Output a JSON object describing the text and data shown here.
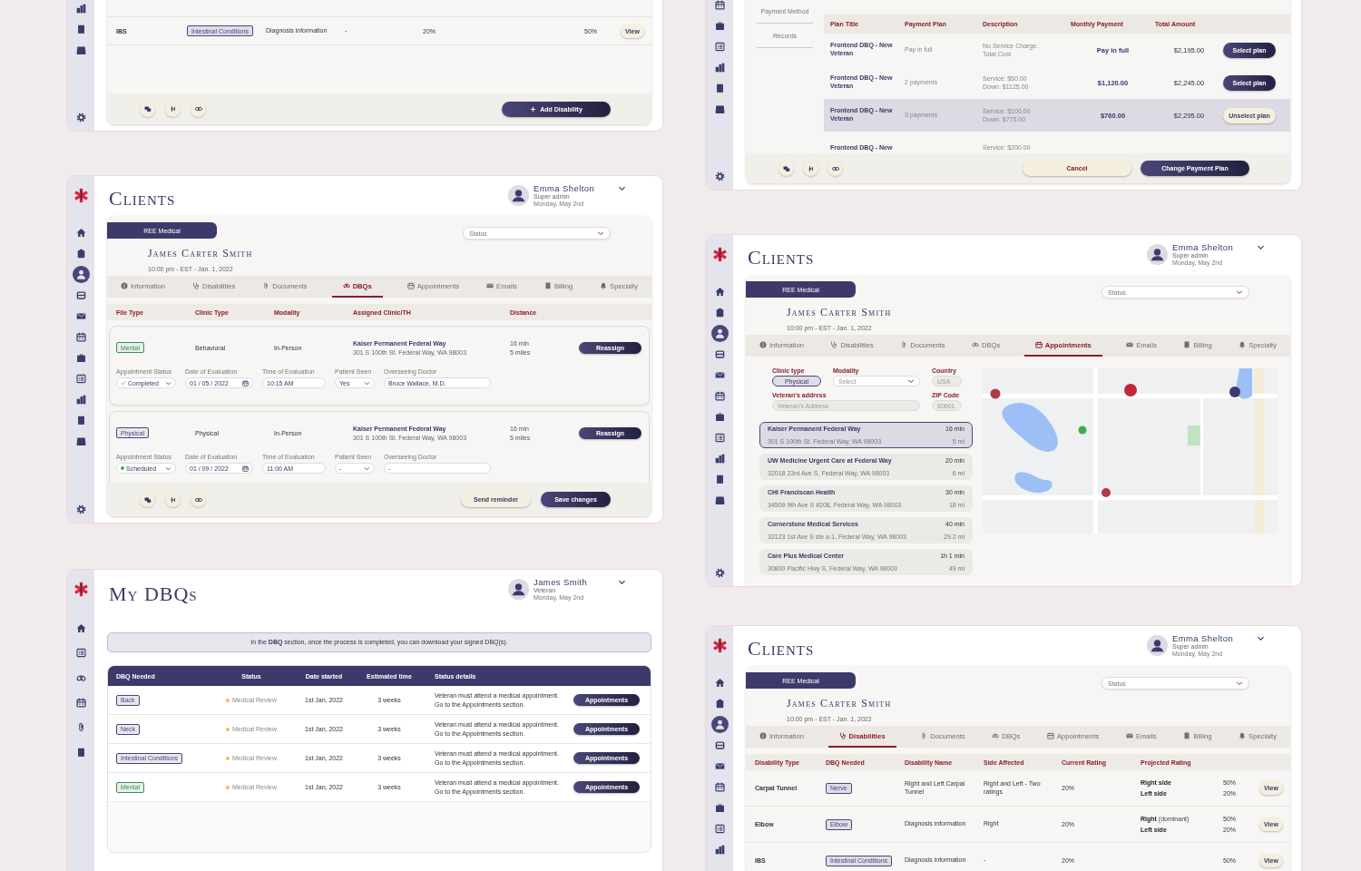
{
  "disabilities_tail": {
    "rows": [
      {
        "type": "IBS",
        "dbq": "Intestinal Conditions",
        "name": "Diagnosis information",
        "side": "-",
        "current": "20%",
        "projected": [
          {
            "value": "50%"
          }
        ],
        "action": "View"
      }
    ],
    "footer_buttons": [
      {
        "label": "Add Disability",
        "kind": "add"
      }
    ]
  },
  "payment_plans": {
    "subnav": [
      "Payment Method",
      "Records"
    ],
    "columns": [
      "Plan Title",
      "Payment Plan",
      "Description",
      "Monthly Payment",
      "Total Amount"
    ],
    "rows": [
      {
        "title": "Frontend DBQ - New Veteran",
        "plan": "Pay in full",
        "description": [
          "No Service Charge.",
          "Total Cost"
        ],
        "monthly": "Pay in full",
        "total": "$2,195.00",
        "action": "Select plan",
        "selected": false
      },
      {
        "title": "Frontend DBQ - New Veteran",
        "plan": "2 payments",
        "description": [
          "Service: $50.00",
          "Down: $1125.00"
        ],
        "monthly": "$1,120.00",
        "total": "$2,245.00",
        "action": "Select plan",
        "selected": false
      },
      {
        "title": "Frontend DBQ - New Veteran",
        "plan": "3 payments",
        "description": [
          "Service: $100.00",
          "Down: $775.00"
        ],
        "monthly": "$760.00",
        "total": "$2,295.00",
        "action": "Unselect plan",
        "selected": true
      },
      {
        "title": "Frontend DBQ - New",
        "description": [
          "Service: $200.00"
        ],
        "selected": false
      }
    ],
    "footer_buttons": [
      {
        "label": "Cancel",
        "kind": "cancel"
      },
      {
        "label": "Change Payment Plan",
        "kind": "primary"
      }
    ]
  },
  "clients_dbqs": {
    "sidebar": [
      {
        "selected": false
      },
      {
        "selected": false
      },
      {
        "selected": true
      },
      {
        "selected": false
      },
      {
        "selected": false
      },
      {
        "selected": false
      },
      {
        "selected": false
      },
      {
        "selected": false
      },
      {
        "selected": false
      },
      {
        "selected": false
      },
      {
        "selected": false
      }
    ],
    "title": "Clients",
    "user": {
      "name": "Emma Shelton",
      "role": "Super admin",
      "date": "Monday, May 2nd"
    },
    "client": {
      "org": "REE Medical",
      "name": "James Carter Smith",
      "meta": "10:00 pm - EST - Jan. 1, 2022"
    },
    "status_filter": {
      "placeholder": "Status"
    },
    "tabs": [
      {
        "label": "Information",
        "selected": false
      },
      {
        "label": "Disabilities",
        "selected": false
      },
      {
        "label": "Documents",
        "selected": false
      },
      {
        "label": "DBQs",
        "selected": true
      },
      {
        "label": "Appointments",
        "selected": false
      },
      {
        "label": "Emails",
        "selected": false
      },
      {
        "label": "Billing",
        "selected": false
      },
      {
        "label": "Specialty",
        "selected": false
      }
    ],
    "columns": [
      "File Type",
      "Clinic Type",
      "Modality",
      "Assigned Clinic/TH",
      "Distance"
    ],
    "rows": [
      {
        "file_type": "Mental",
        "color": "#3e8e55",
        "clinic_type": "Behavioral",
        "modality": "In-Person",
        "clinic": "Kaiser Permanent Federal Way",
        "address": "301 S 100th St. Federal Way, WA 98003",
        "time": "16 min",
        "distance": "5 miles",
        "action": "Reassign",
        "fields": [
          {
            "kind": "status",
            "label": "Appointment Status",
            "value": "Completed",
            "completed": true
          },
          {
            "kind": "date",
            "label": "Date of Evaluation",
            "value": "01 / 05 / 2022"
          },
          {
            "kind": "text",
            "label": "Time of Evaluation",
            "value": "10:15 AM"
          },
          {
            "kind": "select",
            "label": "Patient Seen",
            "value": "Yes"
          },
          {
            "kind": "text",
            "label": "Overseeing Doctor",
            "value": "Bruce Wallace, M.D."
          }
        ]
      },
      {
        "file_type": "Physical",
        "color": "#4a4778",
        "clinic_type": "Physical",
        "modality": "In-Person",
        "clinic": "Kaiser Permanent Federal Way",
        "address": "301 S 100th St. Federal Way, WA 98003",
        "time": "16 min",
        "distance": "5 miles",
        "action": "Reassign",
        "fields": [
          {
            "kind": "status",
            "label": "Appointment Status",
            "value": "Scheduled",
            "completed": false
          },
          {
            "kind": "date",
            "label": "Date of Evaluation",
            "value": "01 / 09 / 2022"
          },
          {
            "kind": "text",
            "label": "Time of Evaluation",
            "value": "11:00 AM"
          },
          {
            "kind": "select",
            "label": "Patient Seen",
            "value": "-"
          },
          {
            "kind": "text",
            "label": "Overseeing Doctor",
            "value": "-"
          }
        ]
      }
    ],
    "footer_buttons": [
      {
        "label": "Send reminder",
        "kind": "secondary"
      },
      {
        "label": "Save changes",
        "kind": "primary"
      }
    ]
  },
  "clients_appointments": {
    "sidebar": [
      {
        "selected": false
      },
      {
        "selected": false
      },
      {
        "selected": true
      },
      {
        "selected": false
      },
      {
        "selected": false
      },
      {
        "selected": false
      },
      {
        "selected": false
      },
      {
        "selected": false
      },
      {
        "selected": false
      },
      {
        "selected": false
      },
      {
        "selected": false
      }
    ],
    "title": "Clients",
    "user": {
      "name": "Emma Shelton",
      "role": "Super admin",
      "date": "Monday, May 2nd"
    },
    "client": {
      "org": "REE Medical",
      "name": "James Carter Smith",
      "meta": "10:00 pm - EST - Jan. 1, 2022"
    },
    "status_filter": {
      "placeholder": "Status"
    },
    "tabs": [
      {
        "label": "Information",
        "selected": false
      },
      {
        "label": "Disabilities",
        "selected": false
      },
      {
        "label": "Documents",
        "selected": false
      },
      {
        "label": "DBQs",
        "selected": false
      },
      {
        "label": "Appointments",
        "selected": true
      },
      {
        "label": "Emails",
        "selected": false
      },
      {
        "label": "Billing",
        "selected": false
      },
      {
        "label": "Specialty",
        "selected": false
      }
    ],
    "form": [
      {
        "kind": "chip",
        "label": "Clinic type",
        "value": "Physical"
      },
      {
        "kind": "select",
        "label": "Modality",
        "placeholder": "Select"
      },
      {
        "kind": "readonly",
        "label": "Country",
        "value": "USA",
        "disabled": true
      },
      {
        "kind": "input",
        "label": "Veteran's address",
        "placeholder": "Veteran's Address"
      },
      {
        "kind": "readonly",
        "label": "ZIP Code",
        "value": "60601",
        "disabled": true
      }
    ],
    "clinics": [
      {
        "name": "Kaiser Permanent Federal Way",
        "time": "16 min",
        "address": "301 S 100th St. Federal Way, WA 98003",
        "distance": "5 mi",
        "selected": true
      },
      {
        "name": "UW Medicine Urgent Care at Federal Way",
        "time": "20 min",
        "address": "32018 23rd Ave S, Federal Way, WA 98003",
        "distance": "6 mi",
        "selected": false
      },
      {
        "name": "CHI Franciscan Health",
        "time": "30 min",
        "address": "34509 9th Ave S #208, Federal Way, WA 98003",
        "distance": "18 mi",
        "selected": false
      },
      {
        "name": "Cornerstone Medical Services",
        "time": "40 min",
        "address": "32123 1st Ave S ste a-1, Federal Way, WA 98003",
        "distance": "29.2 mi",
        "selected": false
      },
      {
        "name": "Care Plus Medical Center",
        "time": "1h 1 min",
        "address": "30800 Pacific Hwy S, Federal Way, WA 98003",
        "distance": "49 mi",
        "selected": false
      }
    ]
  },
  "my_dbqs": {
    "title": "My DBQs",
    "user": {
      "name": "James Smith",
      "role": "Veteran",
      "date": "Monday, May 2nd"
    },
    "notice": "In the **DBQ** section, once the process is completed, you can download your signed DBQ(s).",
    "columns": [
      "DBQ Needed",
      "Status",
      "Date started",
      "Estimated time",
      "Status details"
    ],
    "rows": [
      {
        "dbq": "Back",
        "color": "#4a4778",
        "status": {
          "label": "Medical Review",
          "color": "#f2c230"
        },
        "started": "1st Jan, 2022",
        "estimate": "3 weeks",
        "details": [
          "Veteran must attend a medical appointment.",
          "Go to the Appointments section."
        ],
        "action": "Appointments"
      },
      {
        "dbq": "Neck",
        "color": "#4a4778",
        "status": {
          "label": "Medical Review",
          "color": "#f2c230"
        },
        "started": "1st Jan, 2022",
        "estimate": "3 weeks",
        "details": [
          "Veteran must attend a medical appointment.",
          "Go to the Appointments section."
        ],
        "action": "Appointments"
      },
      {
        "dbq": "Intestinal Conditions",
        "color": "#4a4778",
        "status": {
          "label": "Medical Review",
          "color": "#f2c230"
        },
        "started": "1st Jan, 2022",
        "estimate": "3 weeks",
        "details": [
          "Veteran must attend a medical appointment.",
          "Go to the Appointments section."
        ],
        "action": "Appointments"
      },
      {
        "dbq": "Mental",
        "color": "#3e8e55",
        "status": {
          "label": "Medical Review",
          "color": "#f2c230"
        },
        "started": "1st Jan, 2022",
        "estimate": "3 weeks",
        "details": [
          "Veteran must attend a medical appointment.",
          "Go to the Appointments section."
        ],
        "action": "Appointments"
      }
    ]
  },
  "clients_disabilities": {
    "sidebar": [
      {
        "selected": false
      },
      {
        "selected": false
      },
      {
        "selected": true
      },
      {
        "selected": false
      },
      {
        "selected": false
      },
      {
        "selected": false
      },
      {
        "selected": false
      },
      {
        "selected": false
      },
      {
        "selected": false
      }
    ],
    "title": "Clients",
    "user": {
      "name": "Emma Shelton",
      "role": "Super admin",
      "date": "Monday, May 2nd"
    },
    "client": {
      "org": "REE Medical",
      "name": "James Carter Smith",
      "meta": "10:00 pm - EST - Jan. 1, 2022"
    },
    "status_filter": {
      "placeholder": "Status"
    },
    "tabs": [
      {
        "label": "Information",
        "selected": false
      },
      {
        "label": "Disabilities",
        "selected": true
      },
      {
        "label": "Documents",
        "selected": false
      },
      {
        "label": "DBQs",
        "selected": false
      },
      {
        "label": "Appointments",
        "selected": false
      },
      {
        "label": "Emails",
        "selected": false
      },
      {
        "label": "Billing",
        "selected": false
      },
      {
        "label": "Specialty",
        "selected": false
      }
    ],
    "columns": [
      "Disability Type",
      "DBQ Needed",
      "Disability Name",
      "Side Affected",
      "Current Rating",
      "Projected Rating"
    ],
    "rows": [
      {
        "type": "Carpal Tunnel",
        "dbq": "Nerve",
        "name": "Right and Left Carpal Tunnel",
        "side": "Right and Left - Two ratings",
        "current": "20%",
        "projected": [
          {
            "label": "Right side",
            "value": "50%"
          },
          {
            "label": "Left side",
            "value": "20%"
          }
        ],
        "action": "View"
      },
      {
        "type": "Elbow",
        "dbq": "Elbow",
        "name": "Diagnosis information",
        "side": "Right",
        "current": "20%",
        "projected": [
          {
            "label": "Right",
            "note": "(dominant)",
            "value": "50%"
          },
          {
            "label": "Left side",
            "value": "20%"
          }
        ],
        "action": "View"
      },
      {
        "type": "IBS",
        "dbq": "Intestinal Conditions",
        "name": "Diagnosis information",
        "side": "-",
        "current": "20%",
        "projected": [
          {
            "value": "50%"
          }
        ],
        "action": "View"
      }
    ]
  }
}
